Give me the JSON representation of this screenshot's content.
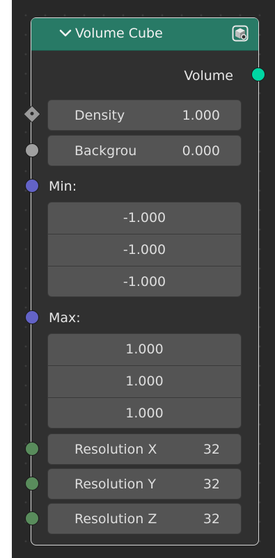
{
  "node": {
    "title": "Volume Cube",
    "header_color": "#287a66",
    "icons": {
      "collapse": "chevron-down-icon",
      "preview": "cube-preview-icon"
    }
  },
  "outputs": [
    {
      "label": "Volume",
      "socket_color": "#00d6a3"
    }
  ],
  "inputs": {
    "density": {
      "label": "Density",
      "value": "1.000",
      "socket_color": "#a0a0a0"
    },
    "background": {
      "label": "Backgrou",
      "value": "0.000",
      "socket_color": "#a0a0a0"
    },
    "min": {
      "label": "Min:",
      "values": [
        "-1.000",
        "-1.000",
        "-1.000"
      ],
      "socket_color": "#6363c7"
    },
    "max": {
      "label": "Max:",
      "values": [
        "1.000",
        "1.000",
        "1.000"
      ],
      "socket_color": "#6363c7"
    },
    "resolution_x": {
      "label": "Resolution X",
      "value": "32",
      "socket_color": "#598c5c"
    },
    "resolution_y": {
      "label": "Resolution Y",
      "value": "32",
      "socket_color": "#598c5c"
    },
    "resolution_z": {
      "label": "Resolution Z",
      "value": "32",
      "socket_color": "#598c5c"
    }
  }
}
